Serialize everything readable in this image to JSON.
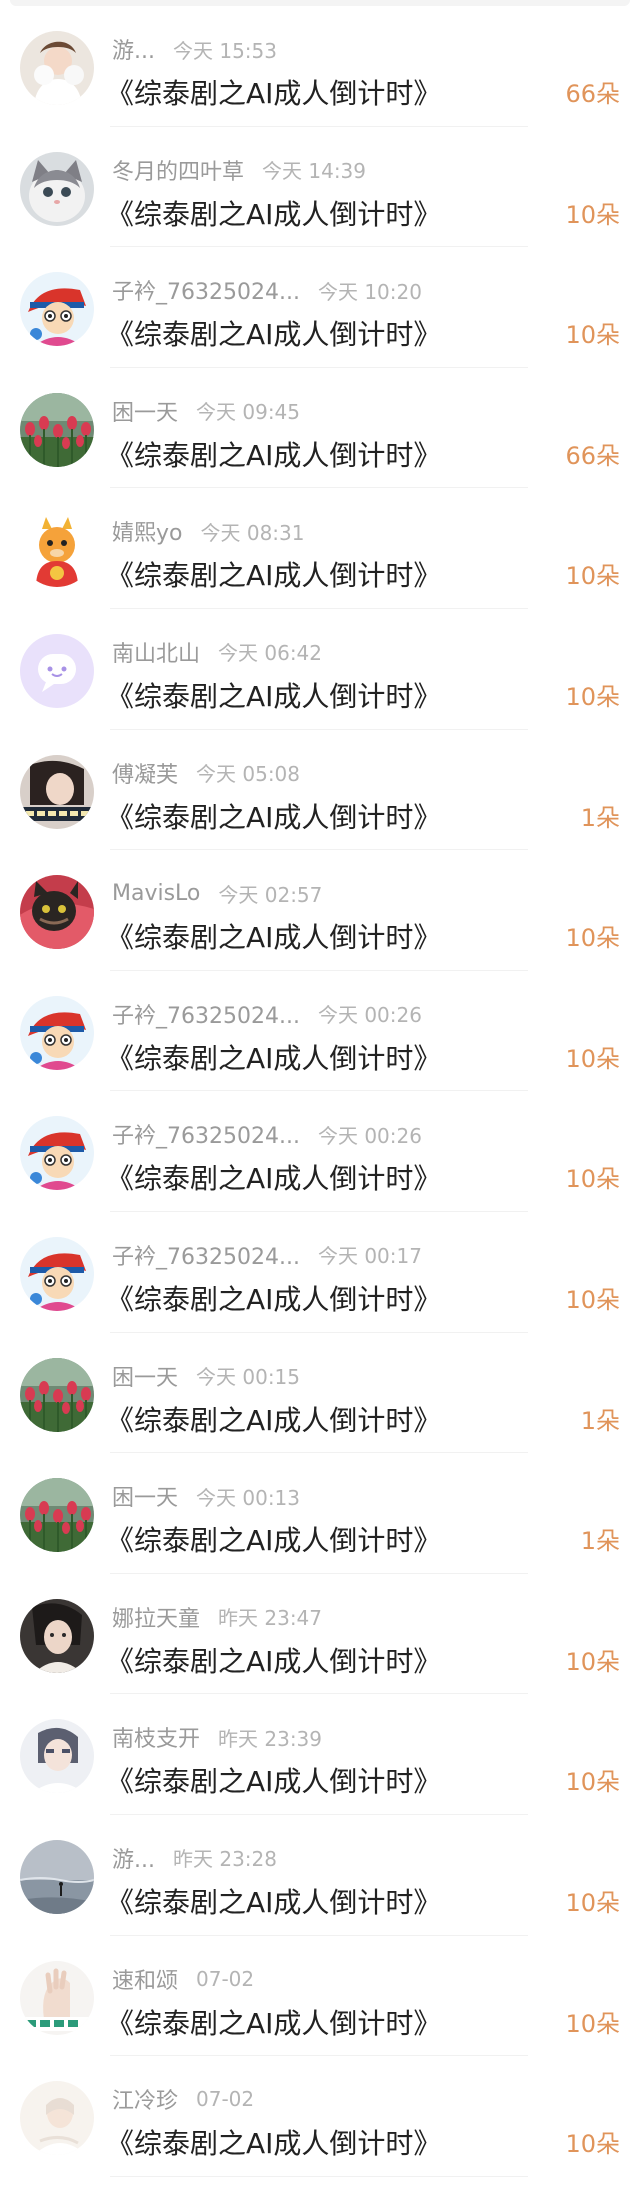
{
  "colors": {
    "amount": "#e0945a",
    "name": "#9a9a9a",
    "time": "#b4b4b4",
    "text": "#222222"
  },
  "rows": [
    {
      "name": "游...",
      "time": "今天 15:53",
      "message": "《综泰剧之AI成人倒计时》",
      "amount": "66朵",
      "avatar": "avatar-girl-white-fluffy"
    },
    {
      "name": "冬月的四叶草",
      "time": "今天 14:39",
      "message": "《综泰剧之AI成人倒计时》",
      "amount": "10朵",
      "avatar": "avatar-cat"
    },
    {
      "name": "子衿_76325024...",
      "time": "今天 10:20",
      "message": "《综泰剧之AI成人倒计时》",
      "amount": "10朵",
      "avatar": "avatar-cartoon-boy"
    },
    {
      "name": "困一天",
      "time": "今天 09:45",
      "message": "《综泰剧之AI成人倒计时》",
      "amount": "66朵",
      "avatar": "avatar-tulips"
    },
    {
      "name": "婧熙yo",
      "time": "今天 08:31",
      "message": "《综泰剧之AI成人倒计时》",
      "amount": "10朵",
      "avatar": "avatar-cartoon-dragon"
    },
    {
      "name": "南山北山",
      "time": "今天 06:42",
      "message": "《综泰剧之AI成人倒计时》",
      "amount": "10朵",
      "avatar": "avatar-default-purple"
    },
    {
      "name": "傅凝芙",
      "time": "今天 05:08",
      "message": "《综泰剧之AI成人倒计时》",
      "amount": "1朵",
      "avatar": "avatar-photo-girl-text"
    },
    {
      "name": "MavisLo",
      "time": "今天 02:57",
      "message": "《综泰剧之AI成人倒计时》",
      "amount": "10朵",
      "avatar": "avatar-cat-dark"
    },
    {
      "name": "子衿_76325024...",
      "time": "今天 00:26",
      "message": "《综泰剧之AI成人倒计时》",
      "amount": "10朵",
      "avatar": "avatar-cartoon-boy"
    },
    {
      "name": "子衿_76325024...",
      "time": "今天 00:26",
      "message": "《综泰剧之AI成人倒计时》",
      "amount": "10朵",
      "avatar": "avatar-cartoon-boy"
    },
    {
      "name": "子衿_76325024...",
      "time": "今天 00:17",
      "message": "《综泰剧之AI成人倒计时》",
      "amount": "10朵",
      "avatar": "avatar-cartoon-boy"
    },
    {
      "name": "困一天",
      "time": "今天 00:15",
      "message": "《综泰剧之AI成人倒计时》",
      "amount": "1朵",
      "avatar": "avatar-tulips"
    },
    {
      "name": "困一天",
      "time": "今天 00:13",
      "message": "《综泰剧之AI成人倒计时》",
      "amount": "1朵",
      "avatar": "avatar-tulips"
    },
    {
      "name": "娜拉天童",
      "time": "昨天 23:47",
      "message": "《综泰剧之AI成人倒计时》",
      "amount": "10朵",
      "avatar": "avatar-photo-person-dark"
    },
    {
      "name": "南枝支开",
      "time": "昨天 23:39",
      "message": "《综泰剧之AI成人倒计时》",
      "amount": "10朵",
      "avatar": "avatar-photo-person-light"
    },
    {
      "name": "游...",
      "time": "昨天 23:28",
      "message": "《综泰剧之AI成人倒计时》",
      "amount": "10朵",
      "avatar": "avatar-landscape-sea"
    },
    {
      "name": "速和颂",
      "time": "07-02",
      "message": "《综泰剧之AI成人倒计时》",
      "amount": "10朵",
      "avatar": "avatar-photo-hand-text"
    },
    {
      "name": "江冷珍",
      "time": "07-02",
      "message": "《综泰剧之AI成人倒计时》",
      "amount": "10朵",
      "avatar": "avatar-photo-light"
    }
  ]
}
